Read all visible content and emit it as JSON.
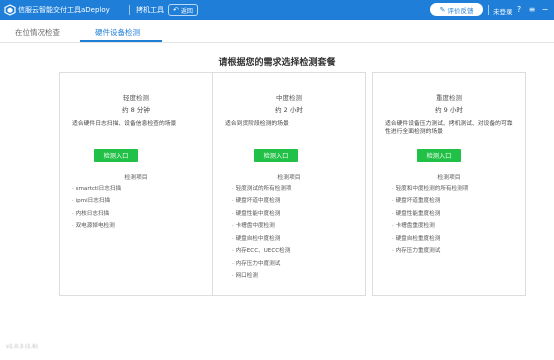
{
  "titlebar": {
    "app_title": "信服云智能交付工具aDeploy",
    "tool_title": "拷机工具",
    "back_label": "返回",
    "feedback_label": "评价反馈",
    "login_label": "未登录",
    "icons": [
      "logo-icon",
      "back-arrow-icon",
      "pen-icon",
      "help-icon",
      "menu-icon",
      "minimize-icon",
      "close-icon"
    ]
  },
  "tabs": [
    {
      "label": "在位情况检查",
      "active": false
    },
    {
      "label": "硬件设备检测",
      "active": true
    }
  ],
  "heading": "请根据您的需求选择检测套餐",
  "cards": [
    {
      "name": "轻度检测",
      "time": "约 8 分钟",
      "desc": "适合硬件日志扫描、设备信息检查的场景",
      "button": "检测入口",
      "items_title": "检测项目",
      "items": [
        "smartctl日志扫描",
        "ipmi日志扫描",
        "内核日志扫描",
        "双电源掉电检测"
      ]
    },
    {
      "name": "中度检测",
      "time": "约 2 小时",
      "desc": "适合到货阶段检测的场景",
      "button": "检测入口",
      "items_title": "检测项目",
      "items": [
        "轻度测试的所有检测项",
        "硬盘坏道中度检测",
        "硬盘性能中度检测",
        "卡槽盘中度检测",
        "硬盘自检中度检测",
        "内存ECC、UECC检测",
        "内存压力中度测试",
        "网口检测"
      ]
    },
    {
      "name": "重度检测",
      "time": "约 9 小时",
      "desc": "适合硬件设备压力测试、拷机测试、对设备的可靠性进行全面检测的场景",
      "button": "检测入口",
      "items_title": "检测项目",
      "items": [
        "轻度和中度检测的所有检测项",
        "硬盘坏道重度检测",
        "硬盘性能重度检测",
        "卡槽盘重度检测",
        "硬盘自检重度检测",
        "内存压力重度测试"
      ]
    }
  ],
  "footer": "v1.0.3 (1.6)",
  "colors": {
    "titlebar": "#1f7fd8",
    "accent": "#1f7fd8",
    "button_green": "#21c046"
  }
}
